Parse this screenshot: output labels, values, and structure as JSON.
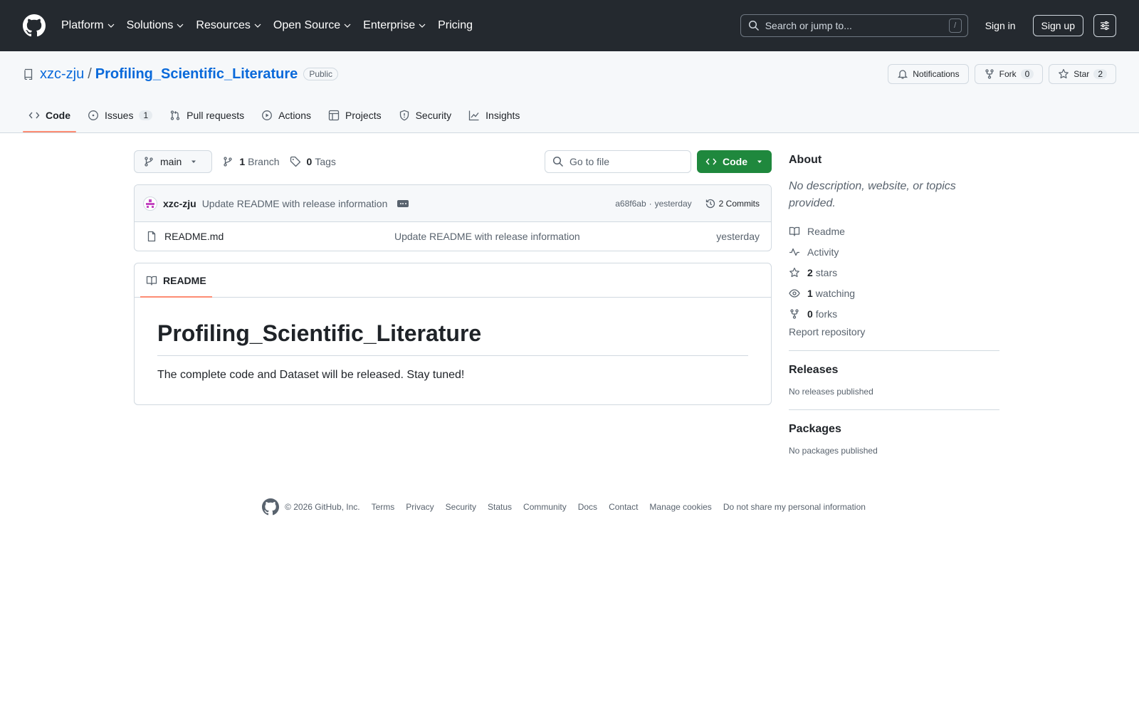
{
  "header": {
    "nav": [
      "Platform",
      "Solutions",
      "Resources",
      "Open Source",
      "Enterprise",
      "Pricing"
    ],
    "search_placeholder": "Search or jump to...",
    "search_shortcut": "/",
    "sign_in": "Sign in",
    "sign_up": "Sign up"
  },
  "repo": {
    "owner": "xzc-zju",
    "separator": "/",
    "name": "Profiling_Scientific_Literature",
    "visibility": "Public",
    "notifications": "Notifications",
    "fork_label": "Fork",
    "fork_count": "0",
    "star_label": "Star",
    "star_count": "2"
  },
  "tabs": [
    {
      "label": "Code",
      "icon": "code-icon",
      "active": true
    },
    {
      "label": "Issues",
      "icon": "issue-icon",
      "count": "1"
    },
    {
      "label": "Pull requests",
      "icon": "pull-request-icon"
    },
    {
      "label": "Actions",
      "icon": "play-icon"
    },
    {
      "label": "Projects",
      "icon": "table-icon"
    },
    {
      "label": "Security",
      "icon": "shield-icon"
    },
    {
      "label": "Insights",
      "icon": "graph-icon"
    }
  ],
  "file_nav": {
    "branch": "main",
    "branch_count": "1",
    "branch_label": "Branch",
    "tag_count": "0",
    "tag_label": "Tags",
    "go_to_file": "Go to file",
    "code_button": "Code"
  },
  "commit": {
    "author": "xzc-zju",
    "message": "Update README with release information",
    "sha": "a68f6ab",
    "dot": "·",
    "time": "yesterday",
    "commits": "2 Commits"
  },
  "files": [
    {
      "name": "README.md",
      "message": "Update README with release information",
      "date": "yesterday"
    }
  ],
  "readme": {
    "tab": "README",
    "heading": "Profiling_Scientific_Literature",
    "paragraph": "The complete code and Dataset will be released. Stay tuned!"
  },
  "about": {
    "title": "About",
    "description": "No description, website, or topics provided.",
    "readme": "Readme",
    "activity": "Activity",
    "stars_count": "2",
    "stars_label": "stars",
    "watching_count": "1",
    "watching_label": "watching",
    "forks_count": "0",
    "forks_label": "forks",
    "report": "Report repository"
  },
  "releases": {
    "title": "Releases",
    "empty": "No releases published"
  },
  "packages": {
    "title": "Packages",
    "empty": "No packages published"
  },
  "footer": {
    "copyright": "© 2026 GitHub, Inc.",
    "links": [
      "Terms",
      "Privacy",
      "Security",
      "Status",
      "Community",
      "Docs",
      "Contact",
      "Manage cookies",
      "Do not share my personal information"
    ]
  },
  "colors": {
    "header_bg": "#24292f",
    "link_blue": "#0969da",
    "green_button": "#1f883d",
    "tab_underline": "#fd8c73"
  }
}
